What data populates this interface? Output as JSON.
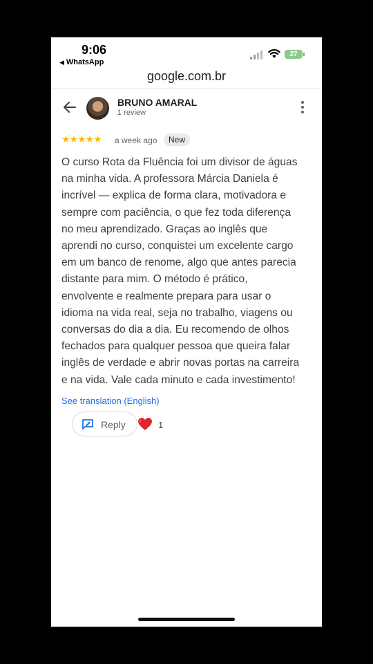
{
  "status_bar": {
    "time": "9:06",
    "back_app": "WhatsApp",
    "battery": "27"
  },
  "browser": {
    "url": "google.com.br"
  },
  "review": {
    "reviewer_name": "BRUNO AMARAL",
    "review_count": "1 review",
    "stars": "★★★★★",
    "rating": 5,
    "date": "a week ago",
    "badge": "New",
    "text": "O curso Rota da Fluência foi um divisor de águas\nna minha vida. A professora Márcia Daniela é\nincrível — explica de forma clara, motivadora e\nsempre com paciência, o que fez toda diferença\nno meu aprendizado. Graças ao inglês que\naprendi no curso, conquistei um excelente cargo\nem um banco de renome, algo que antes parecia\ndistante para mim. O método é prático,\nenvolvente e realmente prepara para usar o\nidioma na vida real, seja no trabalho, viagens ou\nconversas do dia a dia. Eu recomendo de olhos\nfechados para qualquer pessoa que queira falar\ninglês de verdade e abrir novas portas na carreira\ne na vida. Vale cada minuto e cada investimento!",
    "see_translation": "See translation (English)",
    "reply_label": "Reply",
    "reaction_count": "1"
  },
  "icons": {
    "back": "back-arrow-icon",
    "more": "more-vert-icon",
    "reply": "reply-edit-icon",
    "heart": "heart-icon"
  },
  "colors": {
    "star": "#fbbc04",
    "link": "#1a73e8",
    "heart": "#e0262f"
  }
}
